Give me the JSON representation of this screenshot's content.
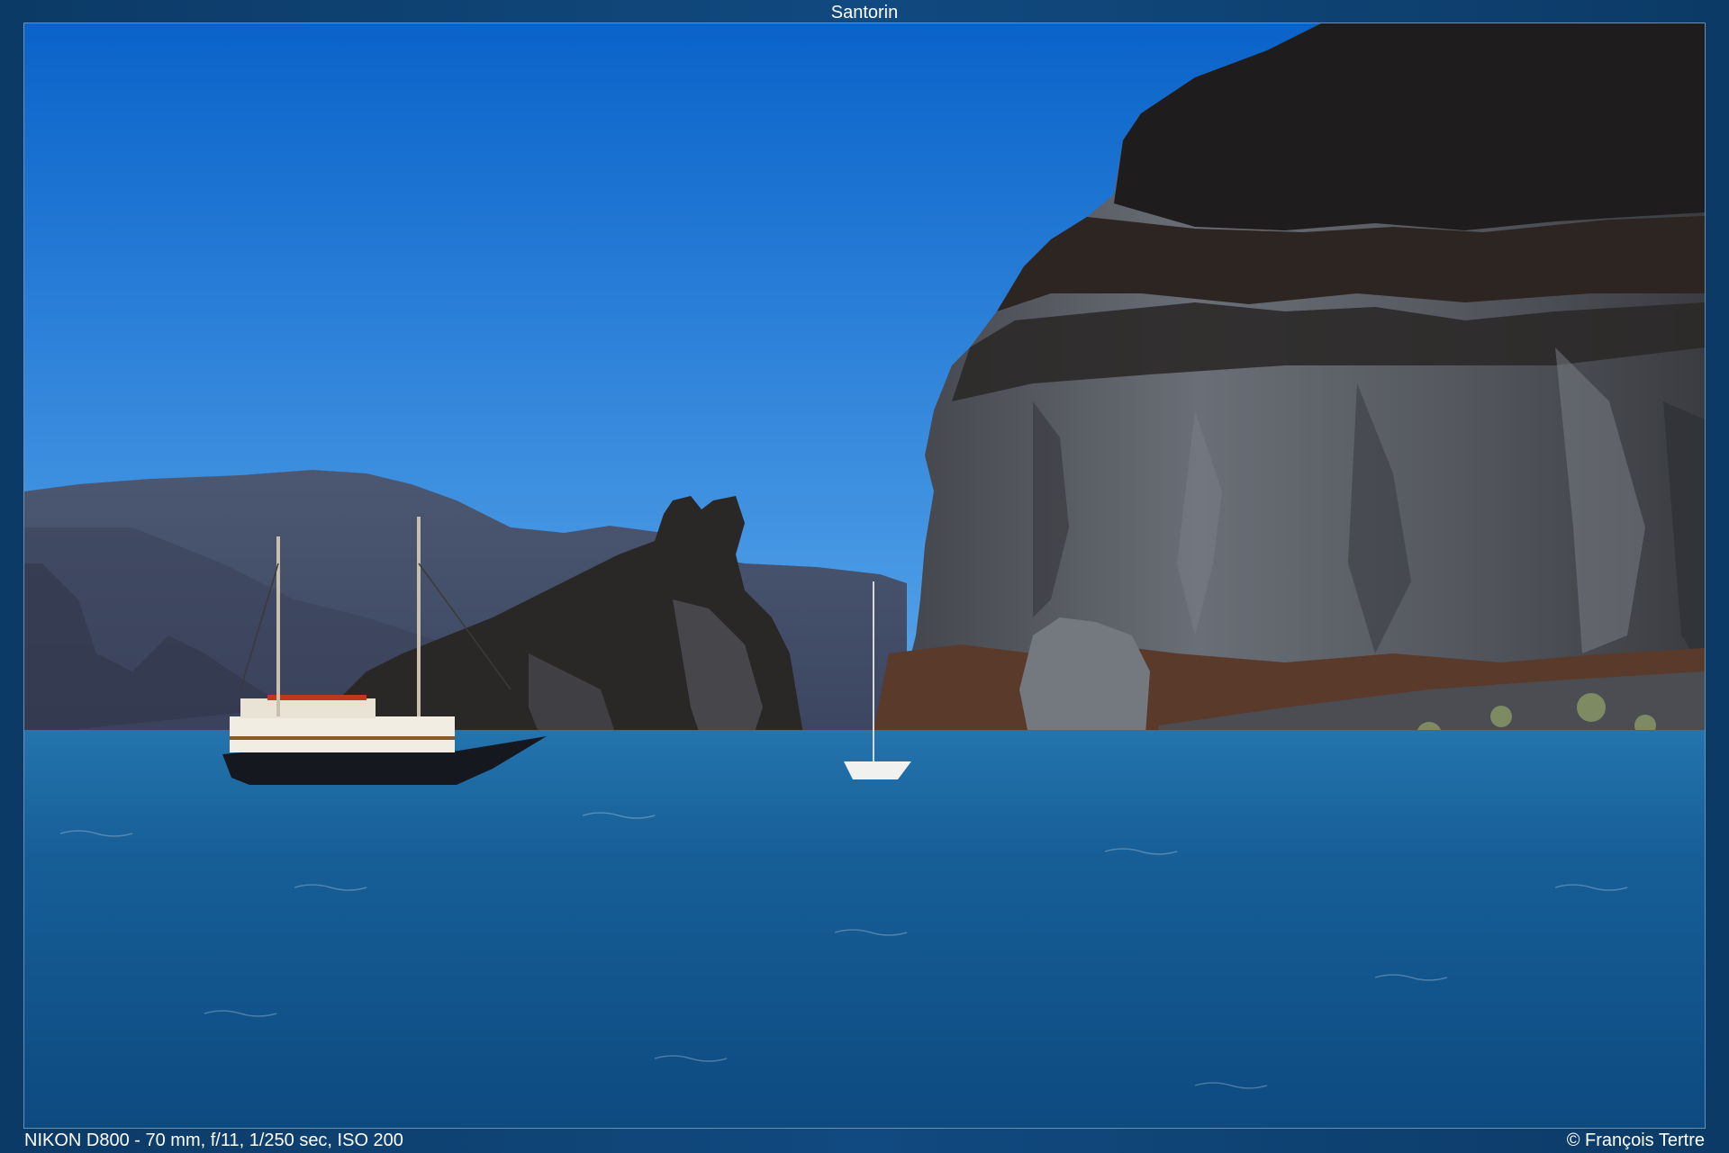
{
  "header": {
    "title": "Santorin"
  },
  "photo": {
    "subject": "sea-cliff-with-sailing-ships",
    "colors": {
      "sky_top": "#0a63c9",
      "sky_bottom": "#4fa3ea",
      "sea_top": "#1f6ea8",
      "sea_bottom": "#0e4f86",
      "cliff_dark": "#1f1c1c",
      "cliff_gray": "#5d6168",
      "distant_hills": "#4a5670"
    }
  },
  "footer": {
    "exif": "NIKON D800 - 70 mm, f/11, 1/250 sec, ISO 200",
    "copyright": "© François Tertre"
  }
}
